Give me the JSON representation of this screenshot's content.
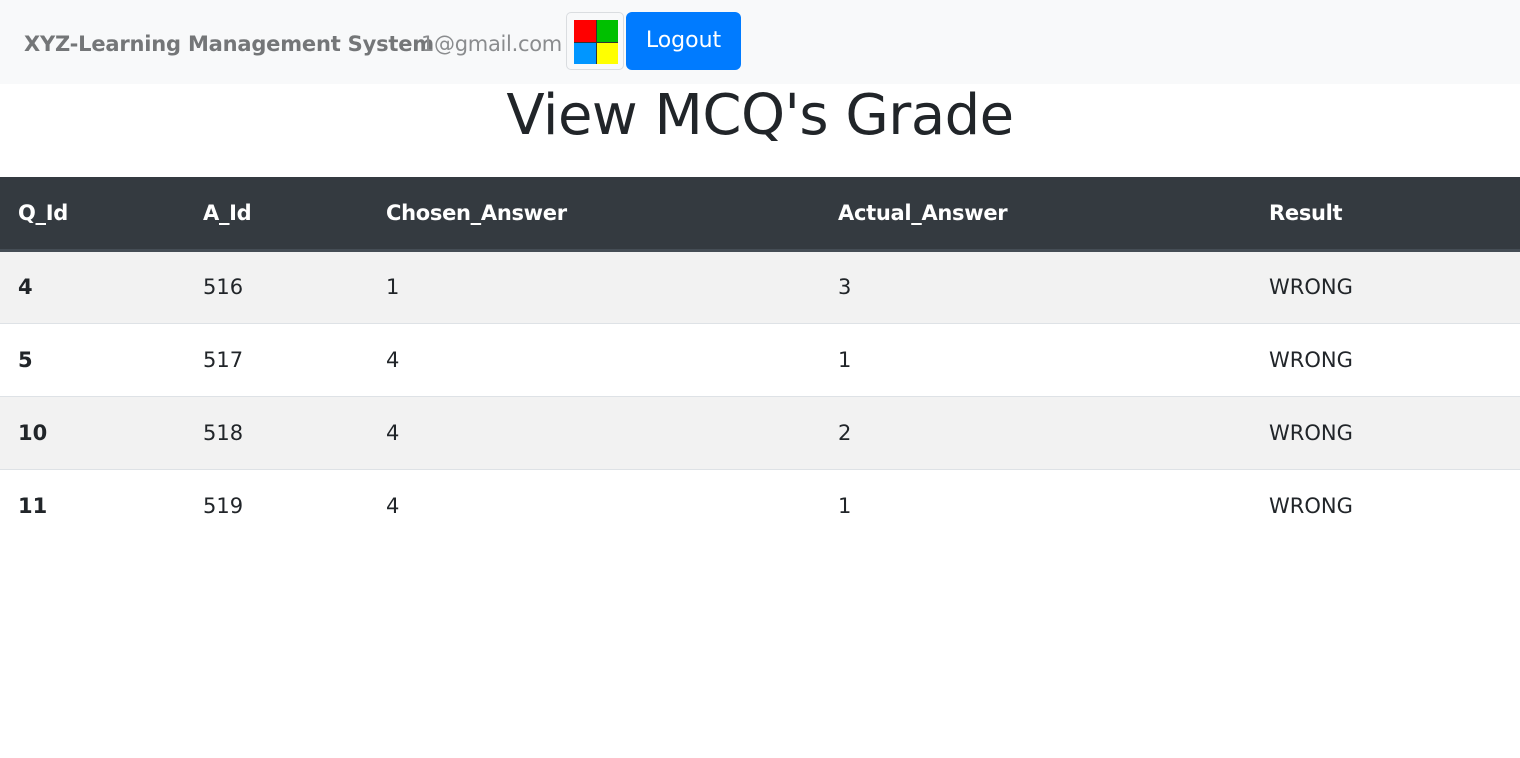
{
  "navbar": {
    "brand": "XYZ-Learning Management System",
    "email": "1@gmail.com",
    "menu_icon_colors": [
      "#ff0000",
      "#00c000",
      "#0096ff",
      "#ffff00"
    ],
    "logout_label": "Logout"
  },
  "page_title": "View MCQ's Grade",
  "table": {
    "headers": [
      "Q_Id",
      "A_Id",
      "Chosen_Answer",
      "Actual_Answer",
      "Result"
    ],
    "rows": [
      [
        "4",
        "516",
        "1",
        "3",
        "WRONG"
      ],
      [
        "5",
        "517",
        "4",
        "1",
        "WRONG"
      ],
      [
        "10",
        "518",
        "4",
        "2",
        "WRONG"
      ],
      [
        "11",
        "519",
        "4",
        "1",
        "WRONG"
      ]
    ]
  },
  "colors": {
    "primary": "#007bff",
    "table_header_bg": "#343a40",
    "navbar_bg": "#f8f9fa",
    "striped_row_bg": "#f2f2f2"
  }
}
